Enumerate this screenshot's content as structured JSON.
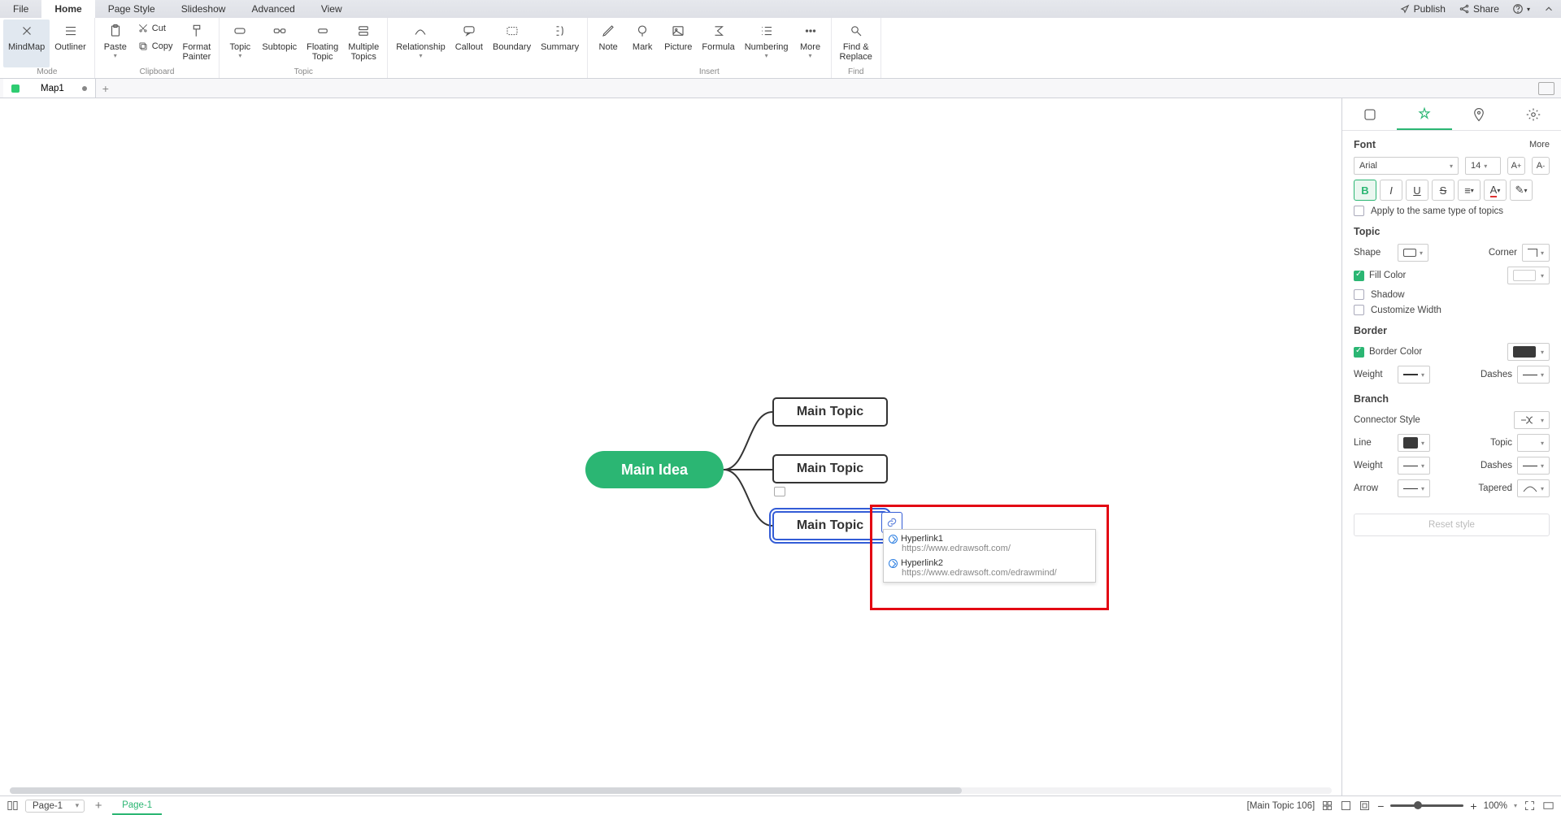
{
  "menu": {
    "file": "File",
    "home": "Home",
    "page_style": "Page Style",
    "slideshow": "Slideshow",
    "advanced": "Advanced",
    "view": "View",
    "publish": "Publish",
    "share": "Share"
  },
  "ribbon": {
    "mode": {
      "label": "Mode",
      "mindmap": "MindMap",
      "outliner": "Outliner"
    },
    "clipboard": {
      "label": "Clipboard",
      "paste": "Paste",
      "cut": "Cut",
      "copy": "Copy",
      "format_painter": "Format\nPainter"
    },
    "topic": {
      "label": "Topic",
      "topic": "Topic",
      "subtopic": "Subtopic",
      "floating": "Floating\nTopic",
      "multiple": "Multiple\nTopics"
    },
    "misc": {
      "relationship": "Relationship",
      "callout": "Callout",
      "boundary": "Boundary",
      "summary": "Summary"
    },
    "insert": {
      "label": "Insert",
      "note": "Note",
      "mark": "Mark",
      "picture": "Picture",
      "formula": "Formula",
      "numbering": "Numbering",
      "more": "More"
    },
    "find": {
      "label": "Find",
      "find_replace": "Find &\nReplace"
    }
  },
  "tabs": {
    "doc1": "Map1"
  },
  "mindmap": {
    "main_idea": "Main Idea",
    "topic1": "Main Topic",
    "topic2": "Main Topic",
    "topic3": "Main Topic"
  },
  "hyperlinks": {
    "h1": {
      "name": "Hyperlink1",
      "url": "https://www.edrawsoft.com/"
    },
    "h2": {
      "name": "Hyperlink2",
      "url": "https://www.edrawsoft.com/edrawmind/"
    }
  },
  "panel": {
    "font": {
      "title": "Font",
      "more": "More",
      "family": "Arial",
      "size": "14",
      "apply_same": "Apply to the same type of topics"
    },
    "topic": {
      "title": "Topic",
      "shape": "Shape",
      "corner": "Corner",
      "fill": "Fill Color",
      "shadow": "Shadow",
      "custom_width": "Customize Width"
    },
    "border": {
      "title": "Border",
      "color": "Border Color",
      "weight": "Weight",
      "dashes": "Dashes"
    },
    "branch": {
      "title": "Branch",
      "connector": "Connector Style",
      "line": "Line",
      "topic": "Topic",
      "weight": "Weight",
      "dashes": "Dashes",
      "arrow": "Arrow",
      "tapered": "Tapered"
    },
    "reset": "Reset style"
  },
  "status": {
    "page_sel": "Page-1",
    "page_tab": "Page-1",
    "selection": "[Main Topic 106]",
    "zoom": "100%"
  }
}
